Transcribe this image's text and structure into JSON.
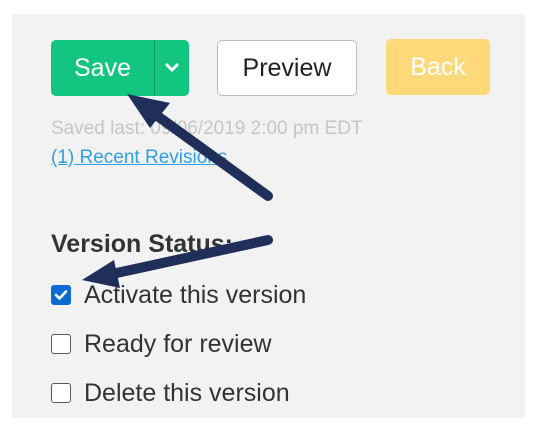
{
  "toolbar": {
    "save_label": "Save",
    "preview_label": "Preview",
    "back_label": "Back"
  },
  "save_meta": {
    "saved_last": "Saved last: 09/06/2019 2:00 pm EDT",
    "recent_revisions": "(1) Recent Revisions"
  },
  "version_status": {
    "heading": "Version Status:",
    "options": [
      {
        "label": "Activate this version",
        "checked": true
      },
      {
        "label": "Ready for review",
        "checked": false
      },
      {
        "label": "Delete this version",
        "checked": false
      }
    ]
  },
  "colors": {
    "save_green": "#12c580",
    "back_yellow": "#fdd97a",
    "link_blue": "#2f9fe6",
    "checkbox_blue": "#0b6bd3",
    "annotation_arrow": "#1f2f5a"
  },
  "icons": {
    "save_dropdown": "chevron-down-icon",
    "checkmark": "checkmark-icon"
  }
}
